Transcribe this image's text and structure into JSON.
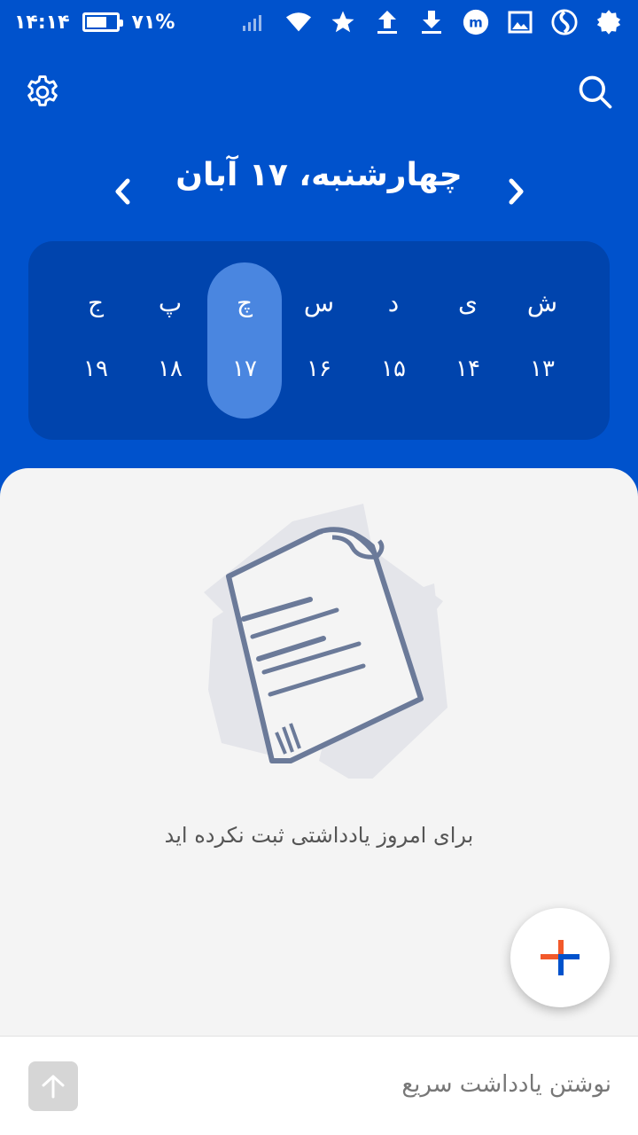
{
  "status_bar": {
    "time": "۱۴:۱۴",
    "battery": "۷۱%",
    "battery_level": 0.71,
    "icons": [
      "signal-icon",
      "wifi-icon",
      "star-icon",
      "upload-icon",
      "download-icon",
      "app-m-icon",
      "gallery-icon",
      "app-s-icon",
      "gear-badge-icon"
    ]
  },
  "header": {
    "date_title": "چهارشنبه، ۱۷ آبان",
    "settings_icon": "gear-icon",
    "search_icon": "search-icon",
    "prev_icon": "chevron-left-icon",
    "next_icon": "chevron-right-icon"
  },
  "week": {
    "days": [
      {
        "name": "ش",
        "num": "۱۳"
      },
      {
        "name": "ی",
        "num": "۱۴"
      },
      {
        "name": "د",
        "num": "۱۵"
      },
      {
        "name": "س",
        "num": "۱۶"
      },
      {
        "name": "چ",
        "num": "۱۷"
      },
      {
        "name": "پ",
        "num": "۱۸"
      },
      {
        "name": "ج",
        "num": "۱۹"
      }
    ],
    "selected_index": 4
  },
  "empty_state": {
    "message": "برای امروز یادداشتی ثبت نکرده اید",
    "illustration": "paper-note-icon"
  },
  "fab": {
    "icon": "plus-icon",
    "colors": [
      "#f2592a",
      "#0052cc"
    ]
  },
  "quick_note": {
    "placeholder": "نوشتن یادداشت سریع",
    "send_icon": "arrow-up-icon"
  },
  "colors": {
    "primary": "#0052cc",
    "week_bg": "#0044ad",
    "selected_day": "#4a86e0",
    "sheet_bg": "#f4f4f4"
  }
}
